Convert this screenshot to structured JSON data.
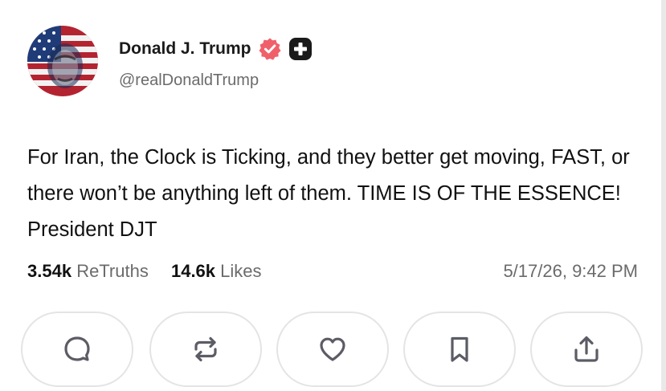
{
  "post": {
    "author": {
      "display_name": "Donald J. Trump",
      "handle": "@realDonaldTrump",
      "verified": true
    },
    "text": "For Iran, the Clock is Ticking, and they better get moving, FAST, or there won’t be anything left of them. TIME IS OF THE ESSENCE! President DJT",
    "stats": {
      "retruths_count": "3.54k",
      "retruths_label": "ReTruths",
      "likes_count": "14.6k",
      "likes_label": "Likes"
    },
    "timestamp": "5/17/26, 9:42 PM"
  },
  "actions": [
    {
      "icon": "reply-icon"
    },
    {
      "icon": "retruth-icon"
    },
    {
      "icon": "heart-icon"
    },
    {
      "icon": "bookmark-icon"
    },
    {
      "icon": "share-icon"
    }
  ],
  "colors": {
    "verified_badge": "#f0606b",
    "plus_badge": "#1a1a1a",
    "muted_text": "#6b6b6b",
    "icon_stroke": "#5c5c66",
    "button_border": "#e4e4e6"
  }
}
